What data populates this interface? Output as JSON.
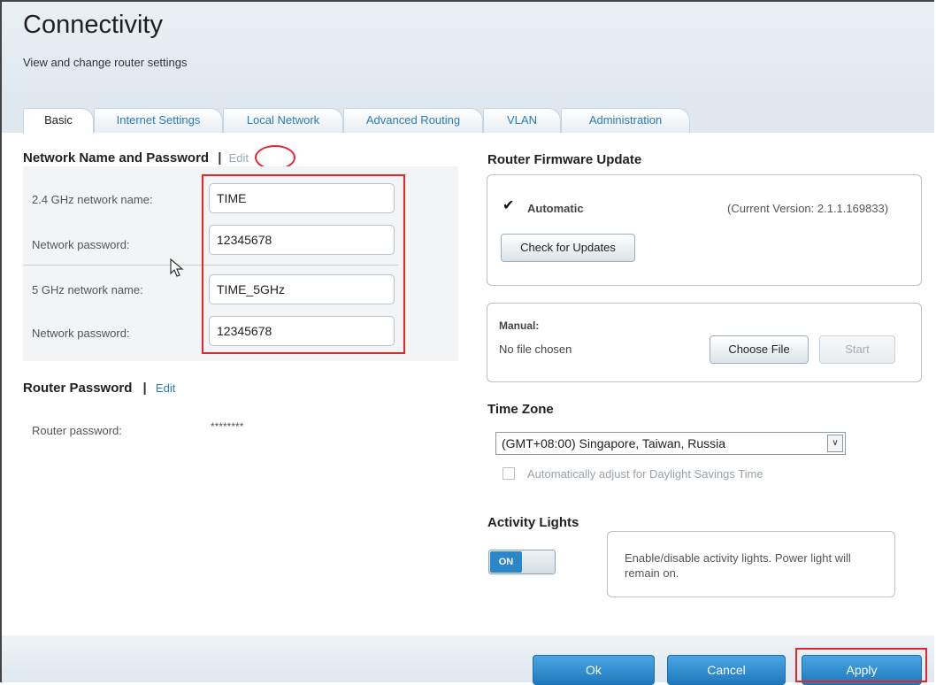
{
  "header": {
    "title": "Connectivity",
    "subtitle": "View and change router settings"
  },
  "tabs": [
    {
      "label": "Basic",
      "active": true
    },
    {
      "label": "Internet Settings",
      "active": false
    },
    {
      "label": "Local Network",
      "active": false
    },
    {
      "label": "Advanced Routing",
      "active": false
    },
    {
      "label": "VLAN",
      "active": false
    },
    {
      "label": "Administration",
      "active": false
    }
  ],
  "network": {
    "title": "Network Name and Password",
    "separator": "|",
    "edit_label": "Edit",
    "fields": [
      {
        "label": "2.4 GHz network name:",
        "value": "TIME"
      },
      {
        "label": "Network password:",
        "value": "12345678"
      },
      {
        "label": "5 GHz network name:",
        "value": "TIME_5GHz"
      },
      {
        "label": "Network password:",
        "value": "12345678"
      }
    ]
  },
  "router_password": {
    "title": "Router Password",
    "separator": "|",
    "edit_label": "Edit",
    "label": "Router password:",
    "value": "********"
  },
  "firmware": {
    "title": "Router Firmware Update",
    "automatic_label": "Automatic",
    "automatic_checked": true,
    "current_version": "(Current Version: 2.1.1.169833)",
    "check_button": "Check for Updates",
    "manual_label": "Manual:",
    "file_status": "No file chosen",
    "choose_button": "Choose File",
    "start_button": "Start"
  },
  "timezone": {
    "title": "Time Zone",
    "selected": "(GMT+08:00) Singapore, Taiwan, Russia",
    "dst_label": "Automatically adjust for Daylight Savings Time",
    "dst_checked": false
  },
  "activity_lights": {
    "title": "Activity Lights",
    "toggle_label": "ON",
    "description": "Enable/disable activity lights. Power light will remain on."
  },
  "footer": {
    "ok_label": "Ok",
    "cancel_label": "Cancel",
    "apply_label": "Apply"
  },
  "colors": {
    "accent": "#2a7ab8",
    "highlight": "#e2262a",
    "button_blue": "#1f79bd"
  }
}
